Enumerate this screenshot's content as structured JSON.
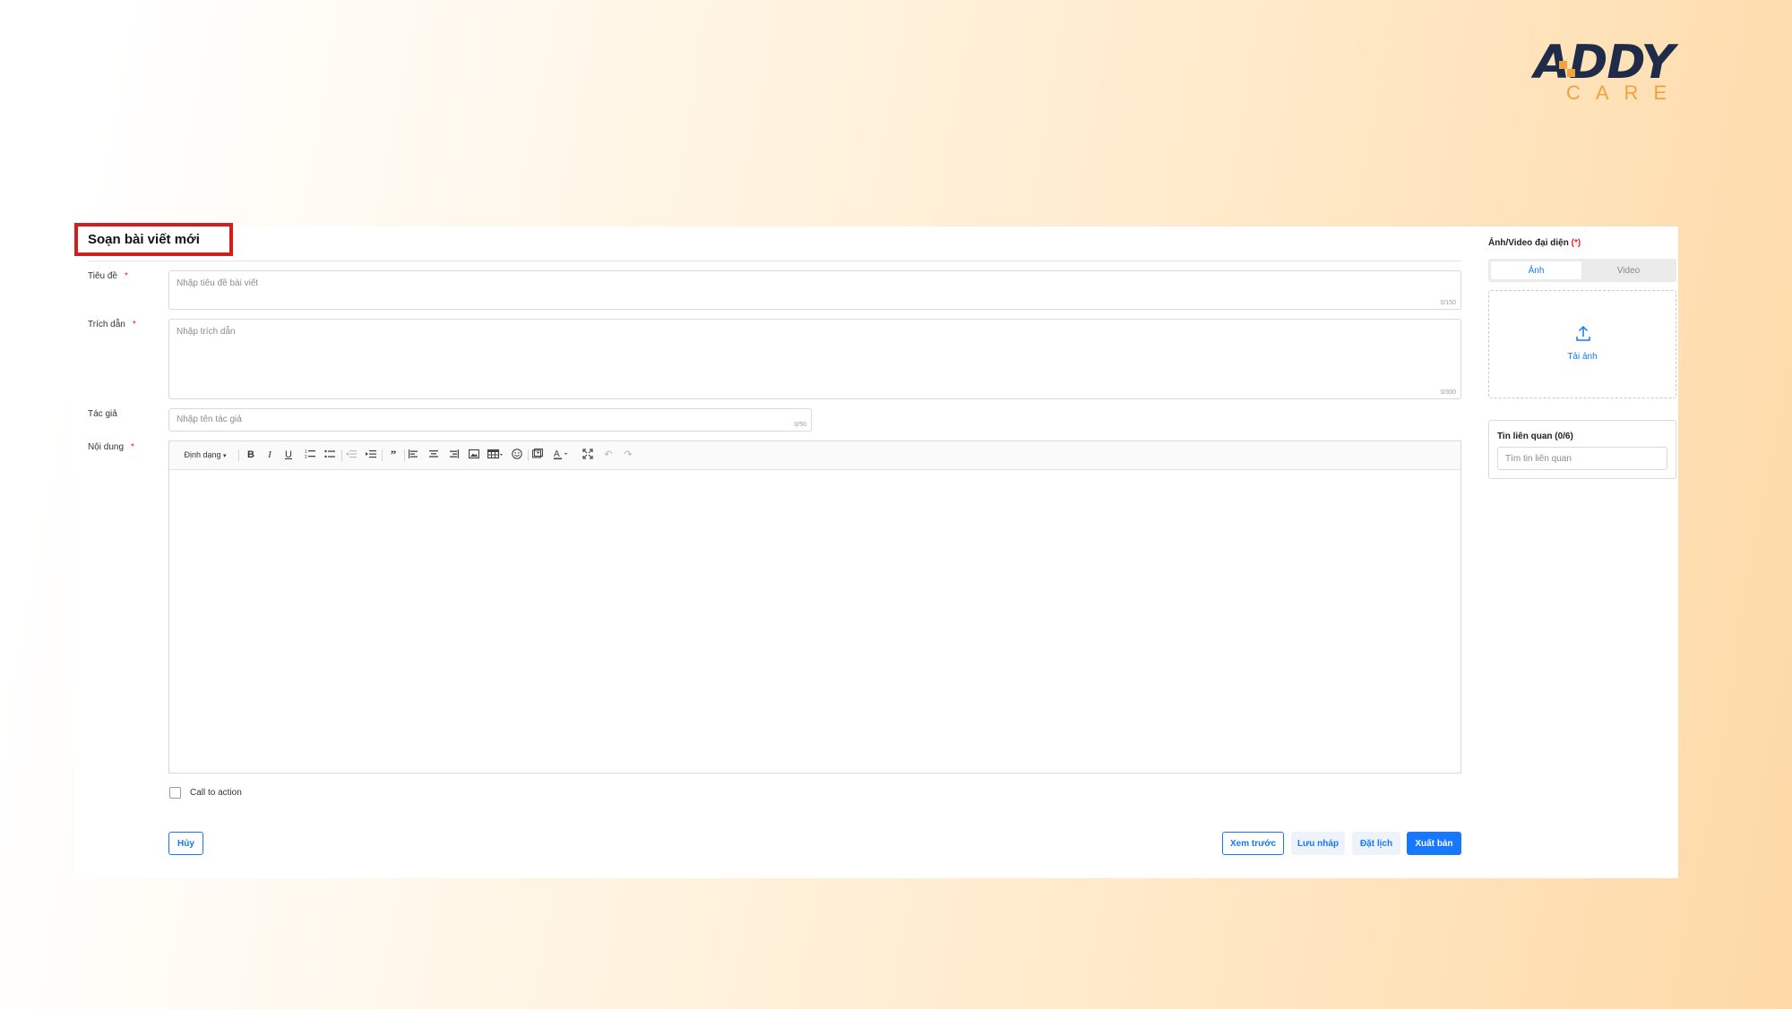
{
  "brand": {
    "logo_word": "ADDY",
    "logo_sub": "CARE",
    "color_navy": "#1e2c4a",
    "color_orange": "#f2a23c"
  },
  "page": {
    "title": "Soạn bài viết mới"
  },
  "form": {
    "title_label": "Tiêu đề",
    "title_placeholder": "Nhập tiêu đề bài viết",
    "title_counter": "0/150",
    "excerpt_label": "Trích dẫn",
    "excerpt_placeholder": "Nhập trích dẫn",
    "excerpt_counter": "0/300",
    "author_label": "Tác giả",
    "author_placeholder": "Nhập tên tác giả",
    "author_counter": "0/50",
    "content_label": "Nội dung",
    "required_mark": "*"
  },
  "toolbar": {
    "format_label": "Định dạng",
    "items": [
      "format-dropdown",
      "bold",
      "italic",
      "underline",
      "ordered-list",
      "unordered-list",
      "outdent",
      "indent",
      "blockquote",
      "align-left",
      "align-center",
      "align-right",
      "image",
      "table",
      "emoji",
      "media",
      "font-color",
      "fullscreen",
      "undo",
      "redo"
    ]
  },
  "cta": {
    "label": "Call to action",
    "checked": false
  },
  "actions": {
    "cancel": "Hủy",
    "preview": "Xem trước",
    "save_draft": "Lưu nháp",
    "schedule": "Đặt lịch",
    "publish": "Xuất bản",
    "accent_color": "#1677ff"
  },
  "media": {
    "title": "Ảnh/Video đại diện",
    "required": "(*)",
    "tabs": [
      "Ảnh",
      "Video"
    ],
    "active_tab": "Ảnh",
    "upload_label": "Tải ảnh"
  },
  "related": {
    "title": "Tin liên quan (0/6)",
    "placeholder": "Tìm tin liên quan"
  }
}
